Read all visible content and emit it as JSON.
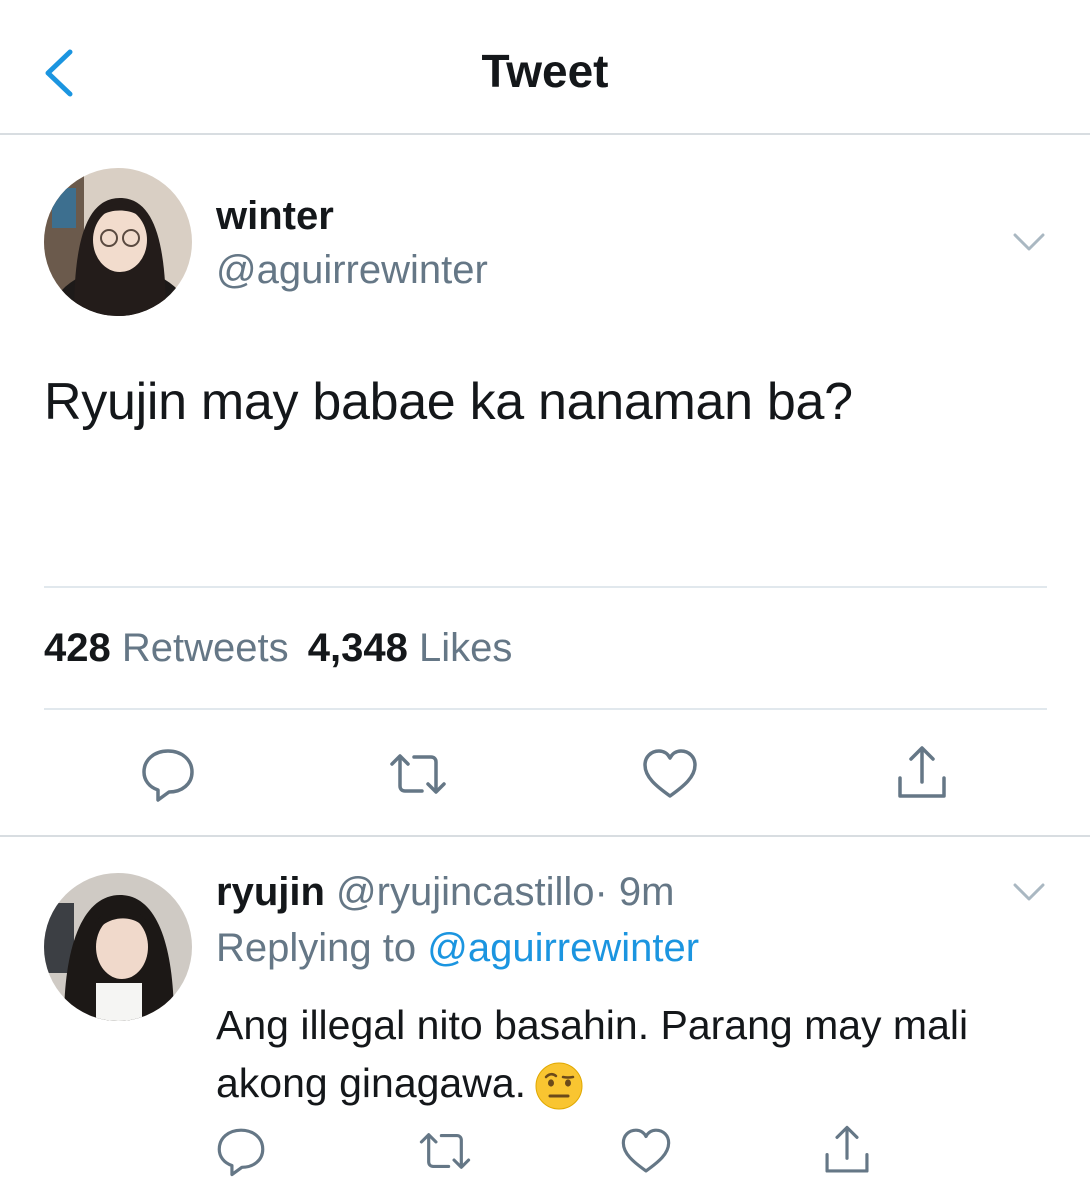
{
  "header": {
    "title": "Tweet",
    "back_icon": "chevron-left-icon"
  },
  "tweet": {
    "author": {
      "name": "winter",
      "handle": "@aguirrewinter"
    },
    "text": "Ryujin may babae ka nanaman ba?",
    "stats": {
      "retweets": "428",
      "retweets_label": "Retweets",
      "likes": "4,348",
      "likes_label": "Likes"
    },
    "actions": [
      "reply-icon",
      "retweet-icon",
      "like-icon",
      "share-icon"
    ]
  },
  "reply": {
    "author": {
      "name": "ryujin",
      "handle": "@ryujincastillo"
    },
    "time": "· 9m",
    "replying_label": "Replying to",
    "replying_to": "@aguirrewinter",
    "text": "Ang illegal nito basahin. Parang may mali akong ginagawa.",
    "emoji": "face-with-raised-eyebrow-emoji"
  },
  "colors": {
    "accent": "#1b95e0",
    "secondary_text": "#657786",
    "primary_text": "#14171a"
  }
}
